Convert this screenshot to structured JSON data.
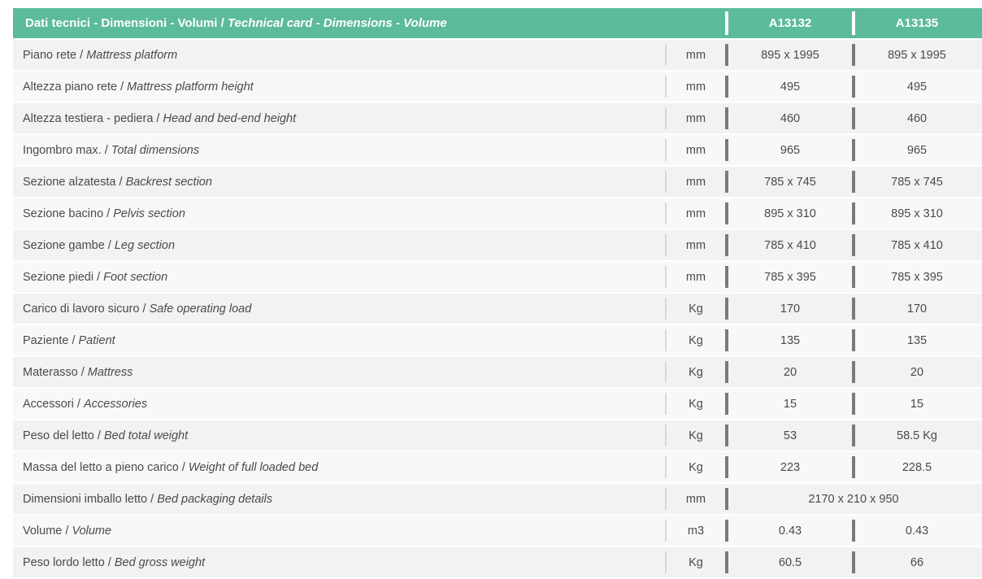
{
  "header": {
    "title_it": "Dati tecnici - Dimensioni - Volumi / ",
    "title_en": "Technical card - Dimensions - Volume",
    "model1": "A13132",
    "model2": "A13135"
  },
  "rows": [
    {
      "it": "Piano rete / ",
      "en": "Mattress platform",
      "unit": "mm",
      "v1": "895 x 1995",
      "v2": "895 x 1995"
    },
    {
      "it": "Altezza piano rete / ",
      "en": "Mattress platform height",
      "unit": "mm",
      "v1": "495",
      "v2": "495"
    },
    {
      "it": "Altezza testiera - pediera / ",
      "en": "Head and bed-end height",
      "unit": "mm",
      "v1": "460",
      "v2": "460"
    },
    {
      "it": "Ingombro max. / ",
      "en": "Total dimensions",
      "unit": "mm",
      "v1": "965",
      "v2": "965"
    },
    {
      "it": "Sezione alzatesta / ",
      "en": "Backrest section",
      "unit": "mm",
      "v1": "785 x 745",
      "v2": "785 x 745"
    },
    {
      "it": "Sezione bacino / ",
      "en": "Pelvis section",
      "unit": "mm",
      "v1": "895 x 310",
      "v2": "895 x 310"
    },
    {
      "it": "Sezione gambe / ",
      "en": "Leg section",
      "unit": "mm",
      "v1": "785 x 410",
      "v2": "785 x 410"
    },
    {
      "it": "Sezione piedi / ",
      "en": "Foot section",
      "unit": "mm",
      "v1": "785 x 395",
      "v2": "785 x 395"
    },
    {
      "it": "Carico di lavoro sicuro / ",
      "en": "Safe operating load",
      "unit": "Kg",
      "v1": "170",
      "v2": "170"
    },
    {
      "it": "Paziente / ",
      "en": "Patient",
      "unit": "Kg",
      "v1": "135",
      "v2": "135"
    },
    {
      "it": "Materasso / ",
      "en": "Mattress",
      "unit": "Kg",
      "v1": "20",
      "v2": "20"
    },
    {
      "it": "Accessori / ",
      "en": "Accessories",
      "unit": "Kg",
      "v1": "15",
      "v2": "15"
    },
    {
      "it": "Peso del letto / ",
      "en": "Bed total weight",
      "unit": "Kg",
      "v1": "53",
      "v2": "58.5 Kg"
    },
    {
      "it": "Massa del letto a pieno carico / ",
      "en": "Weight of full loaded bed",
      "unit": "Kg",
      "v1": "223",
      "v2": "228.5"
    },
    {
      "it": "Dimensioni imballo letto / ",
      "en": "Bed packaging details",
      "unit": "mm",
      "span": "2170 x 210 x 950"
    },
    {
      "it": "Volume  / ",
      "en": "Volume",
      "unit": "m3",
      "v1": "0.43",
      "v2": "0.43"
    },
    {
      "it": "Peso lordo letto / ",
      "en": "Bed gross weight",
      "unit": "Kg",
      "v1": "60.5",
      "v2": "66"
    }
  ],
  "colors": {
    "header": "#5cbb99",
    "row_odd": "#f2f2f2",
    "row_even": "#f8f8f8"
  }
}
